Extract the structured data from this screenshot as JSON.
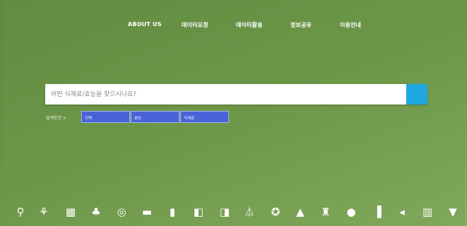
{
  "nav": {
    "items": [
      {
        "label": "ABOUT US"
      },
      {
        "label": "데이터요청"
      },
      {
        "label": "데이터활용"
      },
      {
        "label": "정보공유"
      },
      {
        "label": "이용안내"
      }
    ]
  },
  "search": {
    "placeholder": "어떤 식재료/효능을 찾으시나요?",
    "value": ""
  },
  "filters": {
    "label": "검색조건 >",
    "chips": [
      {
        "label": "지역"
      },
      {
        "label": "효능"
      },
      {
        "label": "식재료"
      }
    ]
  },
  "categories": [
    {
      "icon": "ginseng-icon",
      "glyph": "⚲"
    },
    {
      "icon": "herb-pot-icon",
      "glyph": "⚘"
    },
    {
      "icon": "tofu-icon",
      "glyph": "▦"
    },
    {
      "icon": "mushroom-icon",
      "glyph": "♣"
    },
    {
      "icon": "nut-icon",
      "glyph": "◎"
    },
    {
      "icon": "sandwich-icon",
      "glyph": "▬"
    },
    {
      "icon": "cup-icon",
      "glyph": "▮"
    },
    {
      "icon": "drink-icon",
      "glyph": "◧"
    },
    {
      "icon": "beer-mug-icon",
      "glyph": "◨"
    },
    {
      "icon": "flask-icon",
      "glyph": "⏃"
    },
    {
      "icon": "cookie-icon",
      "glyph": "✪"
    },
    {
      "icon": "pie-icon",
      "glyph": "▲"
    },
    {
      "icon": "wine-icon",
      "glyph": "♜"
    },
    {
      "icon": "apple-icon",
      "glyph": "●"
    },
    {
      "icon": "ice-pop-icon",
      "glyph": "▐"
    },
    {
      "icon": "fish-icon",
      "glyph": "◂"
    },
    {
      "icon": "pitcher-icon",
      "glyph": "▥"
    },
    {
      "icon": "cocktail-icon",
      "glyph": "▼"
    }
  ]
}
